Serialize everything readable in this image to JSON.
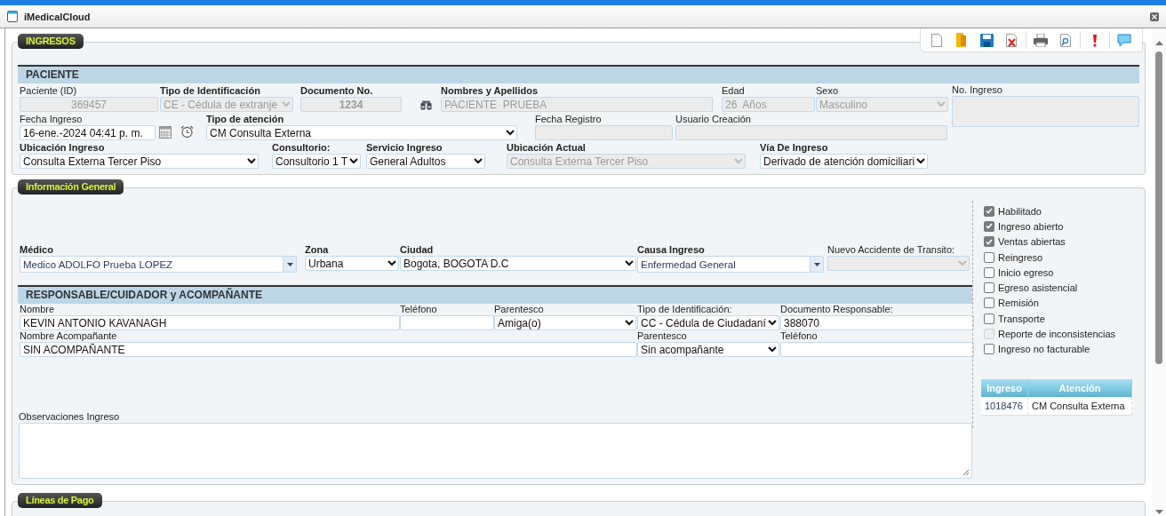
{
  "window": {
    "title": "iMedicalCloud"
  },
  "ingresos": {
    "legend": "INGRESOS",
    "header": "PACIENTE",
    "rows": [
      [
        {
          "label": "Paciente (ID)",
          "value": "369457",
          "kind": "text",
          "disabled": true,
          "required": false
        },
        {
          "label": "Tipo de Identificación",
          "value": "CE - Cédula de extranje",
          "kind": "select",
          "disabled": true,
          "required": true
        },
        {
          "label": "Documento No.",
          "value": "1234",
          "kind": "text",
          "disabled": true,
          "required": true
        },
        {
          "label": "Nombres y Apellidos",
          "value": "PACIENTE  PRUEBA",
          "kind": "text",
          "disabled": true,
          "required": true
        },
        {
          "label": "Edad",
          "value": "26  Años",
          "kind": "text",
          "disabled": true,
          "required": false
        },
        {
          "label": "Sexo",
          "value": "Masculino",
          "kind": "select",
          "disabled": true,
          "required": false
        }
      ],
      [
        {
          "label": "Fecha Ingreso",
          "value": "16-ene.-2024 04:41 p. m.",
          "kind": "text",
          "disabled": false,
          "required": false
        },
        {
          "label": "Tipo de atención",
          "value": "CM Consulta Externa",
          "kind": "select",
          "disabled": false,
          "required": true
        },
        {
          "label": "Fecha Registro",
          "kind": "text",
          "disabled": true,
          "required": false
        },
        {
          "label": "Usuario Creación",
          "kind": "text",
          "disabled": true,
          "required": false
        }
      ],
      [
        {
          "label": "Ubicación Ingreso",
          "value": "Consulta Externa Tercer Piso",
          "kind": "select",
          "disabled": false,
          "required": true
        },
        {
          "label": "Consultorio:",
          "value": "Consultorio 1 T",
          "kind": "select",
          "disabled": false,
          "required": true
        },
        {
          "label": "Servicio Ingreso",
          "value": "General Adultos",
          "kind": "select",
          "disabled": false,
          "required": true
        },
        {
          "label": "Ubicación Actual",
          "value": "Consulta Externa Tercer Piso",
          "kind": "select",
          "disabled": true,
          "required": true
        },
        {
          "label": "Vía De Ingreso",
          "value": "Derivado de atención domiciliari",
          "kind": "select",
          "disabled": false,
          "required": true
        }
      ]
    ],
    "no_ingreso": {
      "label": "No. Ingreso",
      "disabled": true
    }
  },
  "general": {
    "legend": "Información General",
    "rows": [
      [
        {
          "label": "Médico",
          "value": "Medico ADOLFO Prueba LOPEZ",
          "kind": "combo",
          "disabled": false,
          "required": true
        },
        {
          "label": "Zona",
          "value": "Urbana",
          "kind": "select",
          "disabled": false,
          "required": true
        },
        {
          "label": "Ciudad",
          "value": "Bogota, BOGOTA D.C",
          "kind": "select",
          "disabled": false,
          "required": true
        },
        {
          "label": "Causa Ingreso",
          "value": "Enfermedad General",
          "kind": "combo",
          "disabled": false,
          "required": true
        },
        {
          "label": "Nuevo Accidente de Transito:",
          "kind": "select",
          "disabled": true,
          "required": false
        }
      ]
    ],
    "header": "RESPONSABLE/CUIDADOR y ACOMPAÑANTE",
    "responsable_rows": [
      [
        {
          "label": "Nombre",
          "value": "KEVIN ANTONIO KAVANAGH",
          "kind": "text",
          "disabled": false,
          "required": false
        },
        {
          "label": "Teléfono",
          "kind": "text",
          "disabled": false,
          "required": false
        },
        {
          "label": "Parentesco",
          "value": "Amiga(o)",
          "kind": "select",
          "disabled": false,
          "required": false
        },
        {
          "label": "Tipo de Identificación:",
          "value": "CC - Cédula de Ciudadaní",
          "kind": "select",
          "disabled": false,
          "required": false
        },
        {
          "label": "Documento Responsable:",
          "value": "388070",
          "kind": "text",
          "disabled": false,
          "required": false
        }
      ],
      [
        {
          "label": "Nombre Acompañante",
          "value": "SIN ACOMPAÑANTE",
          "kind": "text",
          "disabled": false,
          "required": false
        },
        {
          "label": "Parentesco",
          "value": "Sin acompañante",
          "kind": "select",
          "disabled": false,
          "required": false
        },
        {
          "label": "Teléfono",
          "kind": "text",
          "disabled": false,
          "required": false
        }
      ]
    ],
    "observaciones": {
      "label": "Observaciones Ingreso"
    },
    "checks": [
      {
        "label": "Habilitado",
        "checked": true,
        "disabled": true
      },
      {
        "label": "Ingreso abierto",
        "checked": true,
        "disabled": true
      },
      {
        "label": "Ventas abiertas",
        "checked": true,
        "disabled": true
      },
      {
        "label": "Reingreso",
        "checked": false,
        "disabled": false
      },
      {
        "label": "Inicio egreso",
        "checked": false,
        "disabled": false
      },
      {
        "label": "Egreso asistencial",
        "checked": false,
        "disabled": false
      },
      {
        "label": "Remisión",
        "checked": false,
        "disabled": false
      },
      {
        "label": "Transporte",
        "checked": false,
        "disabled": false
      },
      {
        "label": "Reporte de inconsistencias",
        "checked": false,
        "disabled": true
      },
      {
        "label": "Ingreso no facturable",
        "checked": false,
        "disabled": false
      }
    ],
    "table": {
      "columns": [
        "Ingreso",
        "Atención"
      ],
      "rows": [
        [
          "1018476",
          "CM Consulta Externa"
        ]
      ]
    }
  },
  "pagos": {
    "legend": "Líneas de Pago"
  }
}
